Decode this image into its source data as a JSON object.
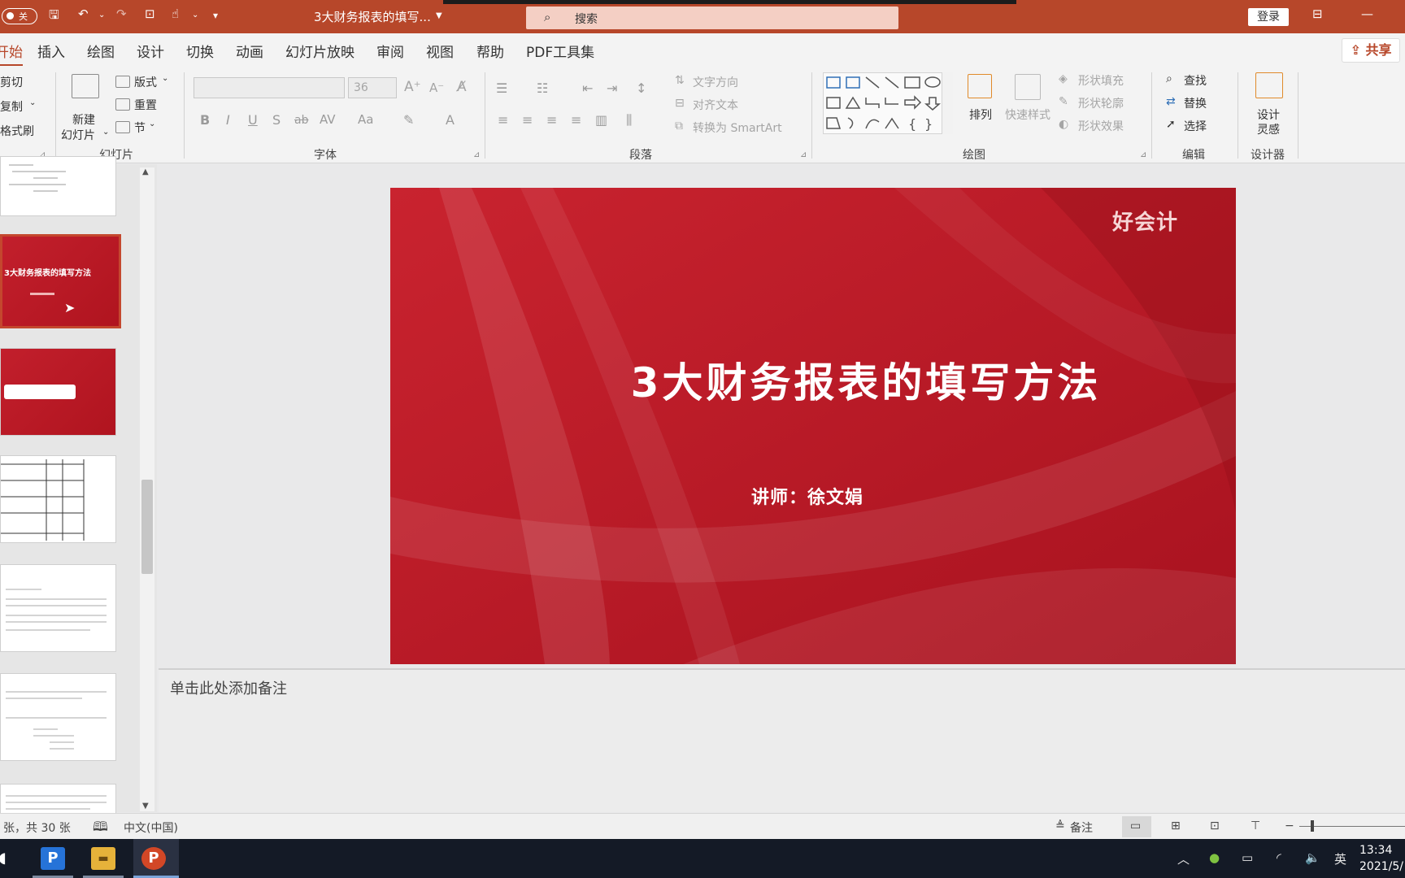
{
  "titlebar": {
    "autosave_label": "关",
    "doc_title": "3大财务报表的填写...",
    "search_placeholder": "搜索",
    "login_label": "登录"
  },
  "tabs": {
    "items": [
      "开始",
      "插入",
      "绘图",
      "设计",
      "切换",
      "动画",
      "幻灯片放映",
      "审阅",
      "视图",
      "帮助",
      "PDF工具集"
    ],
    "share_label": "共享"
  },
  "ribbon": {
    "clipboard": {
      "cut": "剪切",
      "copy": "复制",
      "format_painter": "格式刷"
    },
    "slides": {
      "new_slide_1": "新建",
      "new_slide_2": "幻灯片",
      "layout": "版式",
      "reset": "重置",
      "section": "节",
      "group_label": "幻灯片"
    },
    "font": {
      "size": "36",
      "group_label": "字体"
    },
    "paragraph": {
      "text_direction": "文字方向",
      "align_text": "对齐文本",
      "smartart": "转换为 SmartArt",
      "group_label": "段落"
    },
    "drawing": {
      "arrange": "排列",
      "quick_styles": "快速样式",
      "shape_fill": "形状填充",
      "shape_outline": "形状轮廓",
      "shape_effects": "形状效果",
      "group_label": "绘图"
    },
    "editing": {
      "find": "查找",
      "replace": "替换",
      "select": "选择",
      "group_label": "编辑"
    },
    "designer": {
      "ideas_1": "设计",
      "ideas_2": "灵感",
      "group_label": "设计器"
    }
  },
  "slide": {
    "title": "3大财务报表的填写方法",
    "subtitle": "讲师：徐文娟",
    "brand": "好会计"
  },
  "notes": {
    "placeholder": "单击此处添加备注"
  },
  "statusbar": {
    "slide_count": "张，共 30 张",
    "language": "中文(中国)",
    "notes_button": "备注"
  },
  "taskbar": {
    "time": "13:34",
    "date": "2021/5/",
    "ime": "英"
  },
  "colors": {
    "accent": "#b7472a",
    "slide_red": "#c01c2a"
  }
}
